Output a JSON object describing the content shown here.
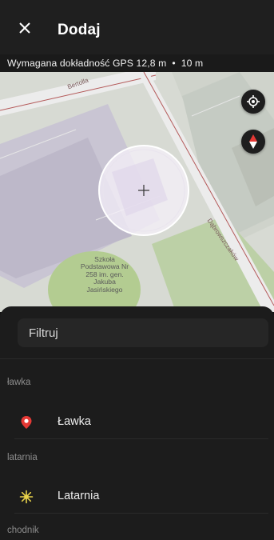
{
  "header": {
    "title": "Dodaj",
    "close_icon": "close-icon"
  },
  "gps": {
    "text": "Wymagana dokładność GPS 12,8 m",
    "separator": "•",
    "required": "10 m"
  },
  "map": {
    "streets": [
      "Bertolla",
      "Dąbrowszczaków"
    ],
    "poi_label": "Szkoła Podstawowa Nr 258 im. gen. Jakuba Jasińskiego",
    "locate_icon": "gps-locate-icon",
    "compass_icon": "compass-icon",
    "crosshair_icon": "crosshair-icon"
  },
  "filter": {
    "placeholder": "Filtruj"
  },
  "sections": [
    {
      "label": "ławka",
      "item_label": "Ławka",
      "icon": "map-pin-icon",
      "icon_color": "#e53935"
    },
    {
      "label": "latarnia",
      "item_label": "Latarnia",
      "icon": "street-lamp-icon",
      "icon_color": "#e8d24a"
    },
    {
      "label": "chodnik"
    }
  ]
}
